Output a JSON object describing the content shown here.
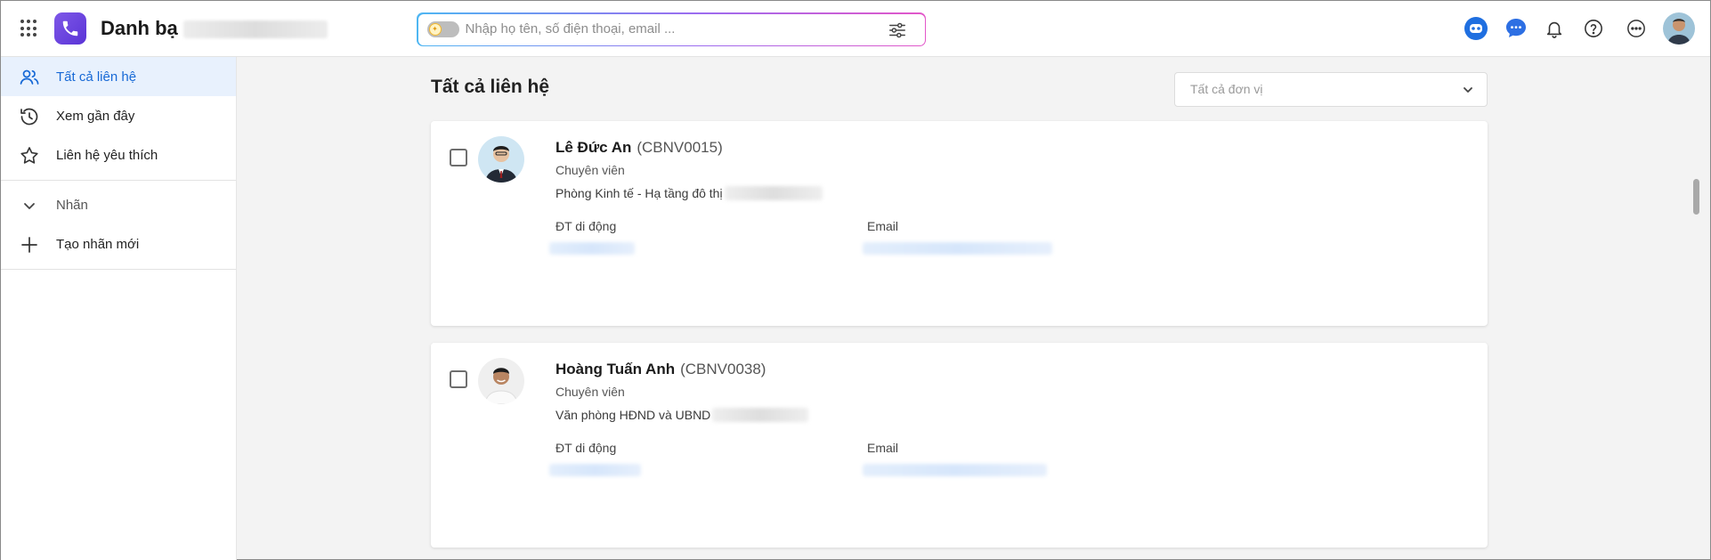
{
  "app": {
    "title": "Danh bạ"
  },
  "search": {
    "placeholder": "Nhập họ tên, số điện thoại, email ..."
  },
  "sidebar": {
    "items": [
      {
        "label": "Tất cả liên hệ",
        "icon": "contacts-icon",
        "active": true
      },
      {
        "label": "Xem gần đây",
        "icon": "history-icon",
        "active": false
      },
      {
        "label": "Liên hệ yêu thích",
        "icon": "star-icon",
        "active": false
      }
    ],
    "labels_section": {
      "label": "Nhãn",
      "icon": "chevron-down-icon"
    },
    "create_label": {
      "label": "Tạo nhãn mới",
      "icon": "plus-icon"
    }
  },
  "main": {
    "title": "Tất cả liên hệ",
    "unit_filter": {
      "placeholder": "Tất cả đơn vị"
    },
    "field_labels": {
      "phone": "ĐT di động",
      "email": "Email"
    },
    "contacts": [
      {
        "name": "Lê Đức An",
        "code": "(CBNV0015)",
        "role": "Chuyên viên",
        "department": "Phòng Kinh tế - Hạ tầng đô thị"
      },
      {
        "name": "Hoàng Tuấn Anh",
        "code": "(CBNV0038)",
        "role": "Chuyên viên",
        "department": "Văn phòng HĐND và UBND"
      }
    ]
  },
  "colors": {
    "accent": "#1769d6",
    "active_bg": "#e8f1fd",
    "brand": "#6a45e0"
  },
  "top_icons": [
    "robot-icon",
    "chat-icon",
    "bell-icon",
    "help-icon",
    "more-icon",
    "user-avatar"
  ]
}
